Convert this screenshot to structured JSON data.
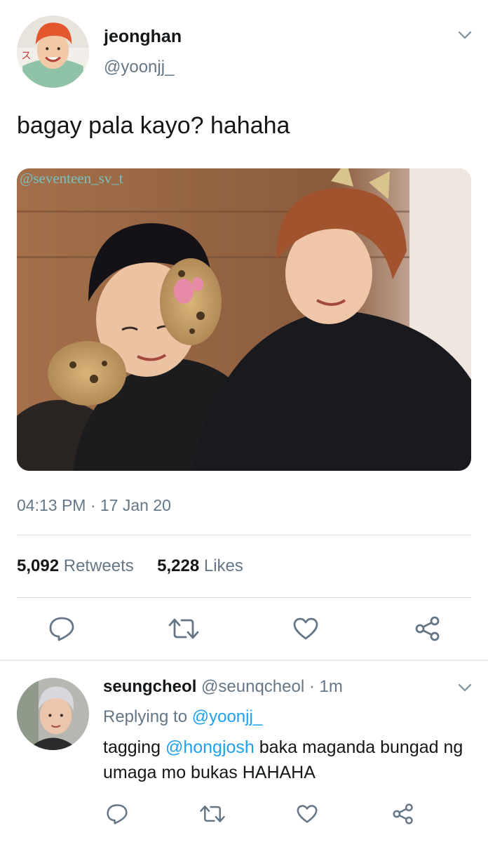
{
  "tweet": {
    "author_name": "jeonghan",
    "author_handle": "@yoonjj_",
    "text": "bagay pala kayo? hahaha",
    "media_watermark": "@seventeen_sv_t",
    "timestamp": "04:13 PM · 17 Jan 20",
    "retweets_count": "5,092",
    "retweets_label": "Retweets",
    "likes_count": "5,228",
    "likes_label": "Likes",
    "avatar_sign_text": "ス"
  },
  "reply": {
    "author_name": "seungcheol",
    "author_handle": "@seunqcheol",
    "time_sep": " · ",
    "time": "1m",
    "replying_prefix": "Replying to ",
    "replying_handle": "@yoonjj_",
    "text_prefix": "tagging ",
    "mention": "@hongjosh",
    "text_rest": " baka maganda bungad ng umaga mo bukas HAHAHA"
  },
  "icons": {
    "reply": "reply-icon",
    "retweet": "retweet-icon",
    "like": "heart-icon",
    "share": "share-icon",
    "more": "chevron-down-icon"
  },
  "colors": {
    "text_primary": "#14171a",
    "text_secondary": "#657786",
    "link": "#1da1f2",
    "watermark": "#77c1c2",
    "divider": "#e6ecf0"
  }
}
